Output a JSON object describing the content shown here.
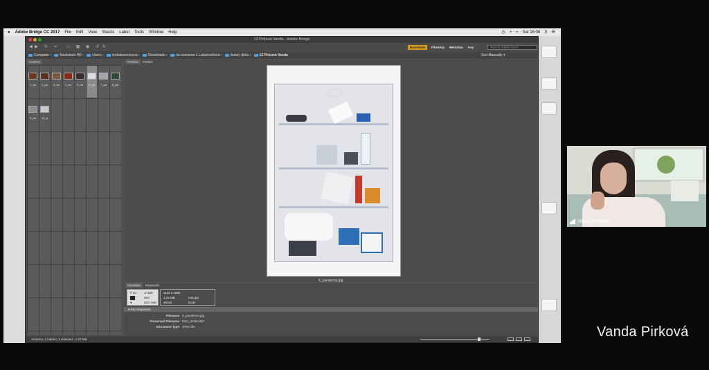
{
  "mac_menubar": {
    "apple": "",
    "app_name": "Adobe Bridge CC 2017",
    "menus": [
      "File",
      "Edit",
      "View",
      "Stacks",
      "Label",
      "Tools",
      "Window",
      "Help"
    ],
    "clock": "Sat 16:08"
  },
  "window": {
    "title": "12 Pirková Vanda - Adobe Bridge"
  },
  "toolbar": {
    "workspaces": [
      "Essentials",
      "Filmstrip",
      "Metadata",
      "Key"
    ],
    "search_placeholder": "Search Adobe Stock"
  },
  "path_bar": {
    "segments": [
      "Computer",
      "Macintosh HD",
      "Users",
      "lenkakocevicova",
      "Downloads",
      "na ocenenie L.Lukačovičová",
      "Autori, diela",
      "12 Pirková Vanda"
    ],
    "sort_label": "Sort Manually"
  },
  "content_panel": {
    "tab": "Content",
    "items": [
      {
        "label": "1_za",
        "sub": "...",
        "color": "#6b3b22"
      },
      {
        "label": "2_pa",
        "sub": "...",
        "color": "#5a2f1e"
      },
      {
        "label": "3_ve",
        "sub": "...",
        "color": "#7a5a3a"
      },
      {
        "label": "4_ku",
        "sub": "...",
        "color": "#8a2a1a"
      },
      {
        "label": "5_mi",
        "sub": "...",
        "color": "#3a2a2a"
      },
      {
        "label": "6_pa",
        "sub": "...",
        "color": "#d9dbe2"
      },
      {
        "label": "7_pa",
        "sub": "...",
        "color": "#a0a4ac"
      },
      {
        "label": "8_pa",
        "sub": "...",
        "color": "#2e4a36"
      },
      {
        "label": "9_pa",
        "sub": "...",
        "color": "#8a8e96"
      },
      {
        "label": "10_p",
        "sub": "...",
        "color": "#c6c8cc"
      }
    ]
  },
  "preview_panel": {
    "tabs": [
      "Preview",
      "Publish"
    ],
    "caption": "6_pandémia.jpg"
  },
  "metadata_panel": {
    "tabs": [
      "Metadata",
      "Keywords"
    ],
    "camera": {
      "aperture": "f/ X1",
      "shutter": "1/ 200",
      "iso": "ISO",
      "ev": "Bit",
      "wb": "ISO: 640"
    },
    "image": {
      "dimensions": "1134 x 1680",
      "size": "1.21 MB",
      "resolution": "240 ppi",
      "color_space": "sRGB",
      "color_mode": "RGB"
    },
    "file_properties_title": "File Properties",
    "properties": [
      {
        "key": "Filename",
        "value": "6_pandémia.jpg"
      },
      {
        "key": "Preserved Filename",
        "value": "DSC_8196.NEF"
      },
      {
        "key": "Document Type",
        "value": "JPEG file"
      }
    ]
  },
  "status_bar": {
    "text": "10 items, 1 hidden, 1 selected - 1.21 MB",
    "zoom_fraction": 0.85
  },
  "participant_video": {
    "name": "Vanda Pirková"
  },
  "speaker_caption": "Vanda Pirková"
}
